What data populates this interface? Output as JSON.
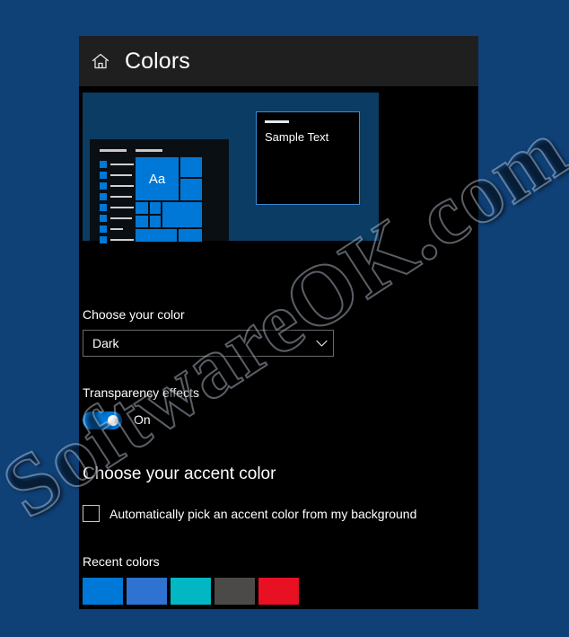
{
  "window": {
    "title": "Colors",
    "home_icon": "home-icon"
  },
  "preview": {
    "tile_text": "Aa",
    "sample_window_text": "Sample Text",
    "wallpaper_color": "#0b3c63",
    "panel_color": "#0a0f14",
    "tile_color": "#0078d7",
    "sample_border_color": "#3a8ad4"
  },
  "choose_color": {
    "label": "Choose your color",
    "selected": "Dark",
    "chevron_icon": "chevron-down-icon"
  },
  "transparency": {
    "label": "Transparency effects",
    "state": "On",
    "enabled": true,
    "on_color": "#0078d7"
  },
  "accent": {
    "heading": "Choose your accent color",
    "auto_pick_label": "Automatically pick an accent color from my background",
    "auto_pick_checked": false
  },
  "recent_colors": {
    "label": "Recent colors",
    "swatches": [
      {
        "name": "blue",
        "hex": "#0078d7"
      },
      {
        "name": "royal-blue",
        "hex": "#2e72d2"
      },
      {
        "name": "teal",
        "hex": "#00b7c3"
      },
      {
        "name": "gray",
        "hex": "#4c4a48"
      },
      {
        "name": "red",
        "hex": "#e81123"
      }
    ]
  },
  "watermark": {
    "text": "SoftwareOK.com"
  },
  "desktop": {
    "background_color": "#0f4076"
  }
}
